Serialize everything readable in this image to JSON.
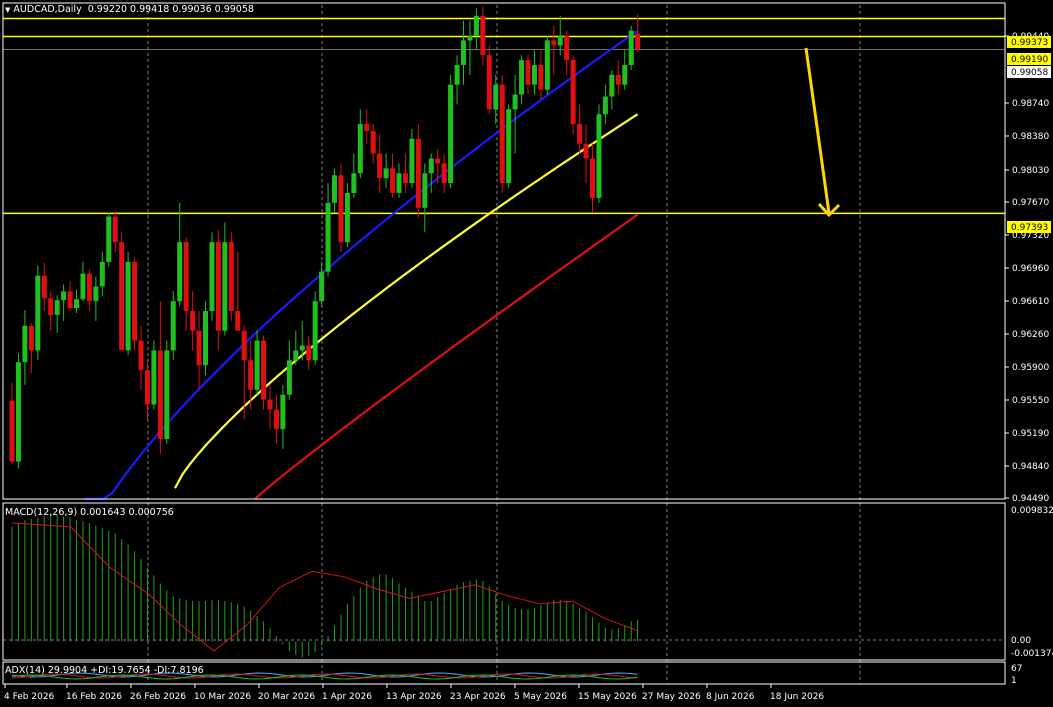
{
  "header": {
    "title": "AUDCAD,Daily",
    "ohlc": "0.99220 0.99418 0.99036 0.99058"
  },
  "macd_label": "MACD(12,26,9) 0.001643 0.000756",
  "adx_label": "ADX(14) 29.9904 +DI:19.7654 -DI:7.8196",
  "colors": {
    "background": "#000000",
    "bull": "#20c020",
    "bear": "#e01010",
    "ma_fast": "#1a1aff",
    "ma_mid": "#ffff33",
    "ma_slow": "#e01010",
    "level": "#ffff00",
    "grid": "#808080",
    "macd_hist": "#20a020",
    "macd_signal": "#e01010"
  },
  "price_scale": [
    "0.99440",
    "0.98740",
    "0.98380",
    "0.98030",
    "0.97670",
    "0.97320",
    "0.96960",
    "0.96610",
    "0.96260",
    "0.95900",
    "0.95550",
    "0.95190",
    "0.94840",
    "0.94490"
  ],
  "price_labels": [
    {
      "text": "0.99373",
      "type": "level"
    },
    {
      "text": "0.99190",
      "type": "level"
    },
    {
      "text": "0.99058",
      "type": "current"
    },
    {
      "text": "0.97393",
      "type": "level"
    }
  ],
  "macd_scale": [
    "0.009832",
    "0.00",
    "-0.001374"
  ],
  "adx_scale": [
    "67",
    "1"
  ],
  "date_labels": [
    "4 Feb 2026",
    "16 Feb 2026",
    "26 Feb 2026",
    "10 Mar 2026",
    "20 Mar 2026",
    "1 Apr 2026",
    "13 Apr 2026",
    "23 Apr 2026",
    "5 May 2026",
    "15 May 2026",
    "27 May 2026",
    "8 Jun 2026",
    "18 Jun 2026"
  ],
  "annotation": {
    "type": "arrow-down",
    "color": "#ffd700"
  },
  "chart_data": {
    "type": "candlestick",
    "symbol": "AUDCAD",
    "timeframe": "Daily",
    "ylim": [
      0.9449,
      0.9951
    ],
    "levels": [
      0.99373,
      0.9919,
      0.97393
    ],
    "current_price": 0.99058,
    "candles": [
      [
        0.9549,
        0.9567,
        0.9485,
        0.9487
      ],
      [
        0.9487,
        0.9597,
        0.948,
        0.9588
      ],
      [
        0.9588,
        0.9641,
        0.9565,
        0.9625
      ],
      [
        0.9625,
        0.9628,
        0.9577,
        0.96
      ],
      [
        0.96,
        0.9686,
        0.959,
        0.9676
      ],
      [
        0.9676,
        0.9689,
        0.964,
        0.9653
      ],
      [
        0.9653,
        0.966,
        0.962,
        0.9636
      ],
      [
        0.9636,
        0.9656,
        0.9618,
        0.9651
      ],
      [
        0.9651,
        0.9667,
        0.963,
        0.966
      ],
      [
        0.966,
        0.967,
        0.964,
        0.9643
      ],
      [
        0.9643,
        0.9662,
        0.9638,
        0.9652
      ],
      [
        0.9652,
        0.969,
        0.965,
        0.9678
      ],
      [
        0.9678,
        0.9682,
        0.964,
        0.965
      ],
      [
        0.965,
        0.9675,
        0.963,
        0.9665
      ],
      [
        0.9665,
        0.97,
        0.9655,
        0.969
      ],
      [
        0.969,
        0.974,
        0.9685,
        0.9736
      ],
      [
        0.9736,
        0.9742,
        0.97,
        0.971
      ],
      [
        0.971,
        0.972,
        0.963,
        0.96
      ],
      [
        0.96,
        0.97,
        0.9595,
        0.969
      ],
      [
        0.969,
        0.9695,
        0.96,
        0.961
      ],
      [
        0.961,
        0.9625,
        0.956,
        0.958
      ],
      [
        0.958,
        0.959,
        0.953,
        0.9545
      ],
      [
        0.9545,
        0.961,
        0.954,
        0.96
      ],
      [
        0.96,
        0.965,
        0.9495,
        0.951
      ],
      [
        0.951,
        0.961,
        0.9505,
        0.96
      ],
      [
        0.96,
        0.966,
        0.959,
        0.965
      ],
      [
        0.965,
        0.975,
        0.9645,
        0.971
      ],
      [
        0.971,
        0.9715,
        0.962,
        0.964
      ],
      [
        0.964,
        0.966,
        0.96,
        0.962
      ],
      [
        0.962,
        0.964,
        0.956,
        0.9585
      ],
      [
        0.9585,
        0.965,
        0.9575,
        0.964
      ],
      [
        0.964,
        0.972,
        0.963,
        0.971
      ],
      [
        0.971,
        0.9722,
        0.96,
        0.962
      ],
      [
        0.962,
        0.973,
        0.9615,
        0.971
      ],
      [
        0.971,
        0.972,
        0.963,
        0.964
      ],
      [
        0.964,
        0.97,
        0.963,
        0.962
      ],
      [
        0.962,
        0.9625,
        0.953,
        0.959
      ],
      [
        0.959,
        0.961,
        0.954,
        0.956
      ],
      [
        0.956,
        0.962,
        0.9555,
        0.961
      ],
      [
        0.961,
        0.9615,
        0.954,
        0.955
      ],
      [
        0.955,
        0.9565,
        0.952,
        0.954
      ],
      [
        0.954,
        0.9555,
        0.9505,
        0.952
      ],
      [
        0.952,
        0.9565,
        0.95,
        0.9555
      ],
      [
        0.9555,
        0.961,
        0.955,
        0.959
      ],
      [
        0.959,
        0.962,
        0.9585,
        0.96
      ],
      [
        0.96,
        0.963,
        0.959,
        0.9605
      ],
      [
        0.9605,
        0.9615,
        0.958,
        0.959
      ],
      [
        0.959,
        0.966,
        0.9585,
        0.965
      ],
      [
        0.965,
        0.969,
        0.9645,
        0.968
      ],
      [
        0.968,
        0.977,
        0.9675,
        0.975
      ],
      [
        0.975,
        0.9785,
        0.974,
        0.9778
      ],
      [
        0.9778,
        0.979,
        0.97,
        0.971
      ],
      [
        0.971,
        0.977,
        0.9705,
        0.976
      ],
      [
        0.976,
        0.98,
        0.9755,
        0.978
      ],
      [
        0.978,
        0.9845,
        0.9775,
        0.983
      ],
      [
        0.983,
        0.9845,
        0.981,
        0.9823
      ],
      [
        0.9823,
        0.983,
        0.979,
        0.98
      ],
      [
        0.98,
        0.982,
        0.976,
        0.9775
      ],
      [
        0.9775,
        0.98,
        0.9765,
        0.9785
      ],
      [
        0.9785,
        0.98,
        0.9755,
        0.976
      ],
      [
        0.976,
        0.979,
        0.9755,
        0.978
      ],
      [
        0.978,
        0.98,
        0.976,
        0.977
      ],
      [
        0.977,
        0.9825,
        0.9765,
        0.9815
      ],
      [
        0.9815,
        0.983,
        0.9735,
        0.9745
      ],
      [
        0.9745,
        0.979,
        0.972,
        0.978
      ],
      [
        0.978,
        0.98,
        0.976,
        0.9795
      ],
      [
        0.9795,
        0.9805,
        0.977,
        0.979
      ],
      [
        0.979,
        0.98,
        0.976,
        0.977
      ],
      [
        0.977,
        0.988,
        0.9765,
        0.987
      ],
      [
        0.987,
        0.99,
        0.985,
        0.989
      ],
      [
        0.989,
        0.9935,
        0.987,
        0.9915
      ],
      [
        0.9915,
        0.9935,
        0.988,
        0.992
      ],
      [
        0.992,
        0.9948,
        0.9905,
        0.994
      ],
      [
        0.994,
        0.995,
        0.989,
        0.99
      ],
      [
        0.99,
        0.991,
        0.984,
        0.9845
      ],
      [
        0.9845,
        0.988,
        0.983,
        0.987
      ],
      [
        0.987,
        0.988,
        0.976,
        0.977
      ],
      [
        0.977,
        0.985,
        0.9765,
        0.9845
      ],
      [
        0.9845,
        0.988,
        0.98,
        0.986
      ],
      [
        0.986,
        0.99,
        0.985,
        0.9895
      ],
      [
        0.9895,
        0.99,
        0.986,
        0.987
      ],
      [
        0.987,
        0.9905,
        0.986,
        0.989
      ],
      [
        0.989,
        0.9905,
        0.9855,
        0.9865
      ],
      [
        0.9865,
        0.992,
        0.986,
        0.9915
      ],
      [
        0.9915,
        0.993,
        0.988,
        0.991
      ],
      [
        0.991,
        0.994,
        0.99,
        0.992
      ],
      [
        0.992,
        0.9925,
        0.988,
        0.9895
      ],
      [
        0.9895,
        0.99,
        0.982,
        0.983
      ],
      [
        0.983,
        0.985,
        0.98,
        0.981
      ],
      [
        0.981,
        0.983,
        0.977,
        0.9795
      ],
      [
        0.9795,
        0.981,
        0.974,
        0.9755
      ],
      [
        0.9755,
        0.985,
        0.975,
        0.984
      ],
      [
        0.984,
        0.987,
        0.983,
        0.9858
      ],
      [
        0.9858,
        0.9885,
        0.9845,
        0.988
      ],
      [
        0.988,
        0.9895,
        0.986,
        0.987
      ],
      [
        0.987,
        0.9905,
        0.9865,
        0.989
      ],
      [
        0.989,
        0.993,
        0.9885,
        0.9925
      ],
      [
        0.9922,
        0.99418,
        0.99036,
        0.99058
      ]
    ],
    "ma_fast_endpoints": [
      0.94,
      0.9925
    ],
    "ma_mid_endpoints": [
      0.946,
      0.984
    ],
    "ma_slow_endpoints": [
      0.9449,
      0.9738
    ],
    "macd": {
      "ylim": [
        -0.001374,
        0.009832
      ],
      "hist": [
        0.0085,
        0.0088,
        0.009,
        0.0091,
        0.0092,
        0.0093,
        0.0094,
        0.0094,
        0.0093,
        0.0092,
        0.009,
        0.0089,
        0.0088,
        0.0086,
        0.0084,
        0.0082,
        0.008,
        0.0076,
        0.0072,
        0.0067,
        0.0061,
        0.0055,
        0.0049,
        0.0043,
        0.0038,
        0.0034,
        0.0032,
        0.0031,
        0.003,
        0.003,
        0.003,
        0.0031,
        0.0031,
        0.003,
        0.0029,
        0.0028,
        0.0026,
        0.0023,
        0.0019,
        0.0015,
        0.001,
        0.0004,
        -0.0002,
        -0.0007,
        -0.001,
        -0.0012,
        -0.0011,
        -0.0008,
        -0.0003,
        0.0004,
        0.0012,
        0.002,
        0.0028,
        0.0034,
        0.004,
        0.0045,
        0.0048,
        0.005,
        0.005,
        0.0047,
        0.0043,
        0.004,
        0.0037,
        0.0034,
        0.003,
        0.003,
        0.0033,
        0.0036,
        0.0039,
        0.0042,
        0.0044,
        0.0045,
        0.0046,
        0.0045,
        0.0041,
        0.0035,
        0.003,
        0.0027,
        0.0025,
        0.0024,
        0.0024,
        0.0025,
        0.0027,
        0.0029,
        0.0031,
        0.0031,
        0.003,
        0.0028,
        0.0025,
        0.0022,
        0.0018,
        0.0014,
        0.001,
        0.0009,
        0.001,
        0.0012,
        0.0015,
        0.0016
      ],
      "signal_points": [
        [
          0,
          0.0088
        ],
        [
          0.18,
          0.0085
        ],
        [
          0.3,
          0.0055
        ],
        [
          0.42,
          0.0035
        ],
        [
          0.52,
          0.0012
        ],
        [
          0.62,
          -0.0007
        ],
        [
          0.72,
          0.0012
        ],
        [
          0.82,
          0.004
        ],
        [
          0.92,
          0.0052
        ],
        [
          1.02,
          0.0048
        ],
        [
          1.12,
          0.0039
        ],
        [
          1.22,
          0.0032
        ],
        [
          1.32,
          0.0037
        ],
        [
          1.42,
          0.0042
        ],
        [
          1.52,
          0.0034
        ],
        [
          1.62,
          0.0028
        ],
        [
          1.72,
          0.003
        ],
        [
          1.82,
          0.0017
        ],
        [
          1.92,
          0.0008
        ]
      ]
    }
  }
}
